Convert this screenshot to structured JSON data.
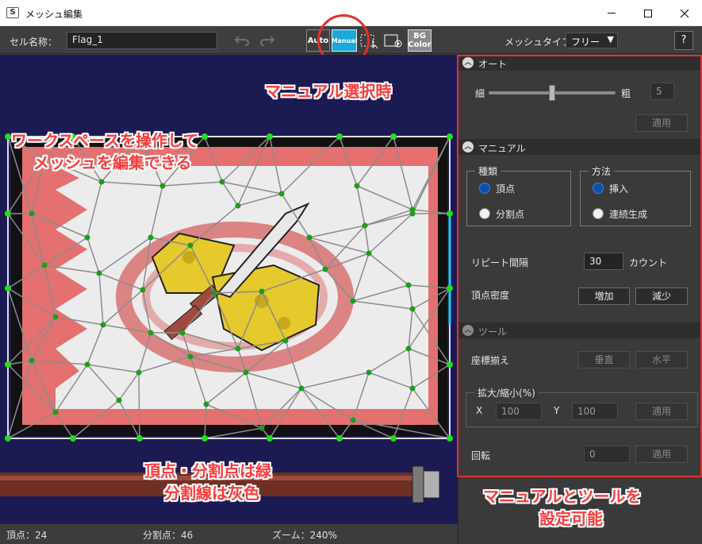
{
  "window": {
    "title": "メッシュ編集",
    "app_icon": "S"
  },
  "toolbar": {
    "cell_name_label": "セル名称：",
    "cell_name_value": "Flag_1",
    "auto_label": "Auto",
    "manual_label": "Manual",
    "bgcolor_label_1": "BG",
    "bgcolor_label_2": "Color",
    "mesh_type_label": "メッシュタイプ：",
    "mesh_type_value": "フリー",
    "help_label": "?"
  },
  "status": {
    "vertex": "頂点：24",
    "split": "分割点：46",
    "zoom": "ズーム：240%"
  },
  "panel": {
    "auto": {
      "title": "オート",
      "fine_label": "細",
      "coarse_label": "粗",
      "slider_fraction": 0.5,
      "spin_value": "5",
      "apply_label": "適用"
    },
    "manual": {
      "title": "マニュアル",
      "type_group": "種類",
      "type_vertex": "頂点",
      "type_split": "分割点",
      "method_group": "方法",
      "method_insert": "挿入",
      "method_continuous": "連続生成",
      "repeat_label": "リピート間隔",
      "repeat_value": "30",
      "repeat_unit": "カウント",
      "density_label": "頂点密度",
      "increase_label": "増加",
      "decrease_label": "減少"
    },
    "tool": {
      "title": "ツール",
      "align_label": "座標揃え",
      "vertical_label": "垂直",
      "horizontal_label": "水平",
      "scale_group": "拡大/縮小(%)",
      "x_label": "X",
      "x_value": "100",
      "y_label": "Y",
      "y_value": "100",
      "scale_apply_label": "適用",
      "rotate_label": "回転",
      "rotate_value": "0",
      "rotate_apply_label": "適用"
    }
  },
  "annotations": {
    "manual_selected": "マニュアル選択時",
    "workspace_1": "ワークスペースを操作して",
    "workspace_2": "メッシュを編集できる",
    "points_1": "頂点・分割点は緑",
    "points_2": "分割線は灰色",
    "panel_1": "マニュアルとツールを",
    "panel_2": "設定可能"
  },
  "colors": {
    "canvas_bg": "#1c1a52",
    "point_green": "#1e9c1e",
    "boundary_green": "#22dd22",
    "split_line_gray": "#8c8c8c",
    "annotation_red": "#e52f2f",
    "manual_active": "#1aa9d8"
  }
}
